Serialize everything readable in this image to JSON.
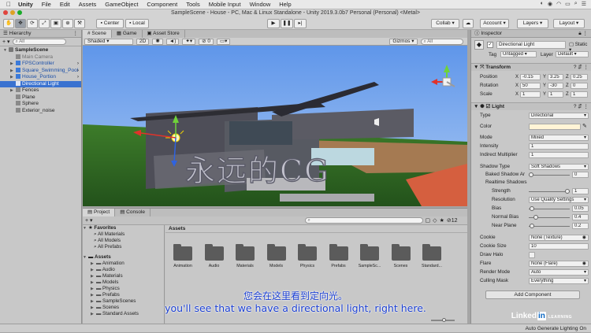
{
  "menubar": {
    "app": "Unity",
    "items": [
      "File",
      "Edit",
      "Assets",
      "GameObject",
      "Component",
      "Tools",
      "Mobile Input",
      "Window",
      "Help"
    ]
  },
  "window": {
    "title": "SampleScene - House - PC, Mac & Linux Standalone - Unity 2019.3.0b7 Personal (Personal) <Metal>"
  },
  "toolbar": {
    "pivot_label": "Center",
    "space_label": "Local",
    "collab_label": "Collab",
    "account_label": "Account",
    "layers_label": "Layers",
    "layout_label": "Layout"
  },
  "hierarchy": {
    "tab_label": "Hierarchy",
    "search_placeholder": "All",
    "items": [
      {
        "label": "SampleScene",
        "depth": 0,
        "kind": "scene",
        "selected": false
      },
      {
        "label": "Main Camera",
        "depth": 1,
        "kind": "gray",
        "selected": false
      },
      {
        "label": "FPSController",
        "depth": 1,
        "kind": "prefab",
        "selected": false
      },
      {
        "label": "Square_Swimming_Pool",
        "depth": 1,
        "kind": "prefab",
        "selected": false
      },
      {
        "label": "House_Portion",
        "depth": 1,
        "kind": "prefab",
        "selected": false
      },
      {
        "label": "Directional Light",
        "depth": 1,
        "kind": "object",
        "selected": true
      },
      {
        "label": "Fences",
        "depth": 1,
        "kind": "object",
        "selected": false
      },
      {
        "label": "Plane",
        "depth": 1,
        "kind": "object",
        "selected": false
      },
      {
        "label": "Sphere",
        "depth": 1,
        "kind": "object",
        "selected": false
      },
      {
        "label": "Exterior_noise",
        "depth": 1,
        "kind": "object",
        "selected": false
      }
    ]
  },
  "scene": {
    "tabs": [
      "Scene",
      "Game",
      "Asset Store"
    ],
    "shading_mode": "Shaded",
    "mode_2d": "2D",
    "hidden_count": "0",
    "gizmos_label": "Gizmos",
    "search_placeholder": "All",
    "watermark": "永远的CG"
  },
  "project": {
    "tabs": [
      "Project",
      "Console"
    ],
    "hidden_count": "12",
    "favorites_label": "Favorites",
    "favorites": [
      "All Materials",
      "All Models",
      "All Prefabs"
    ],
    "assets_root": "Assets",
    "tree": [
      "Animation",
      "Audio",
      "Materials",
      "Models",
      "Physics",
      "Prefabs",
      "SampleScenes",
      "Scenes",
      "Standard Assets"
    ],
    "breadcrumb": "Assets",
    "folders": [
      "Animation",
      "Audio",
      "Materials",
      "Models",
      "Physics",
      "Prefabs",
      "SampleSc...",
      "Scenes",
      "Standard..."
    ]
  },
  "inspector": {
    "tab_label": "Inspector",
    "object_name": "Directional Light",
    "static_label": "Static",
    "tag_label": "Tag",
    "tag_value": "Untagged",
    "layer_label": "Layer",
    "layer_value": "Default",
    "transform": {
      "header": "Transform",
      "position_label": "Position",
      "rotation_label": "Rotation",
      "scale_label": "Scale",
      "position": {
        "x": "-0.15",
        "y": "3.25",
        "z": "0.25"
      },
      "rotation": {
        "x": "50",
        "y": "-30",
        "z": "0"
      },
      "scale": {
        "x": "1",
        "y": "1",
        "z": "1"
      }
    },
    "light": {
      "header": "Light",
      "type_label": "Type",
      "type_value": "Directional",
      "color_label": "Color",
      "color_value": "#fff4d6",
      "mode_label": "Mode",
      "mode_value": "Mixed",
      "intensity_label": "Intensity",
      "intensity_value": "1",
      "indirect_label": "Indirect Multiplier",
      "indirect_value": "1",
      "shadow_type_label": "Shadow Type",
      "shadow_type_value": "Soft Shadows",
      "baked_angle_label": "Baked Shadow Ar",
      "baked_angle_value": "0",
      "baked_angle_fraction": 0.0,
      "realtime_label": "Realtime Shadows",
      "strength_label": "Strength",
      "strength_value": "1",
      "strength_fraction": 1.0,
      "resolution_label": "Resolution",
      "resolution_value": "Use Quality Settings",
      "bias_label": "Bias",
      "bias_value": "0.05",
      "bias_fraction": 0.025,
      "normal_bias_label": "Normal Bias",
      "normal_bias_value": "0.4",
      "normal_bias_fraction": 0.13,
      "near_plane_label": "Near Plane",
      "near_plane_value": "0.2",
      "near_plane_fraction": 0.02,
      "cookie_label": "Cookie",
      "cookie_value": "None (Texture)",
      "cookie_size_label": "Cookie Size",
      "cookie_size_value": "10",
      "draw_halo_label": "Draw Halo",
      "flare_label": "Flare",
      "flare_value": "None (Flare)",
      "render_mode_label": "Render Mode",
      "render_mode_value": "Auto",
      "culling_label": "Culling Mask",
      "culling_value": "Everything"
    },
    "add_component": "Add Component"
  },
  "status": {
    "right_text": "Auto Generate Lighting On"
  },
  "overlay": {
    "subtitle_cn": "您会在这里看到定向光。",
    "subtitle_en": "you'll see that we have a directional light, right here.",
    "brand": "Linked",
    "brand_in": "in",
    "brand_sub": "LEARNING"
  },
  "colors": {
    "selection": "#3a72d0",
    "subtitle": "#1b3fd2",
    "sky_top": "#6aa0ee",
    "grass": "#2f6a25"
  }
}
